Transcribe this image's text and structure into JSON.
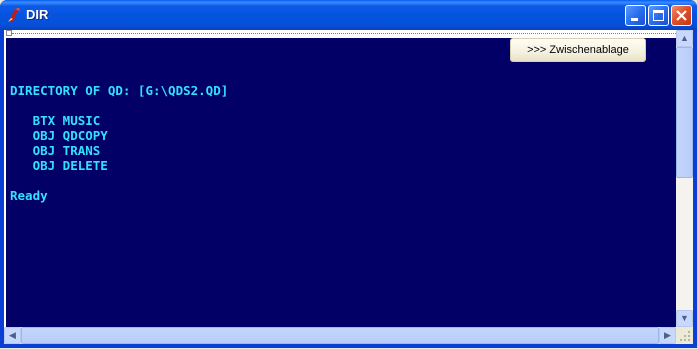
{
  "window": {
    "title": "DIR"
  },
  "toolbar": {
    "clipboard_label": ">>> Zwischenablage"
  },
  "console": {
    "lines": [
      "DIRECTORY OF QD: [G:\\QDS2.QD]",
      "   BTX MUSIC",
      "   OBJ QDCOPY",
      "   OBJ TRANS",
      "   OBJ DELETE",
      "Ready"
    ],
    "text_color": "#33e0ff",
    "background_color": "#020066"
  },
  "scroll": {
    "up": "▲",
    "down": "▼",
    "left": "◀",
    "right": "▶"
  },
  "colors": {
    "titlebar": "#0554e0",
    "close_button": "#e0502a"
  }
}
